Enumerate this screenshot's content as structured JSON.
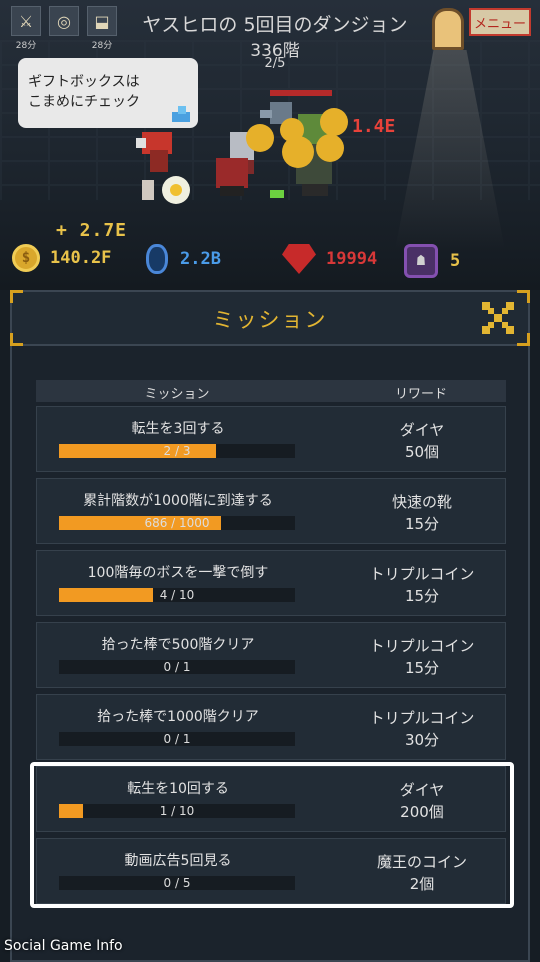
{
  "header": {
    "title": "ヤスヒロの 5回目のダンジョン",
    "floor": "336階",
    "wave": "2/5",
    "menu_label": "メニュー",
    "buffs": [
      {
        "icon": "crossed-swords-icon",
        "time": "28分"
      },
      {
        "icon": "coin-stack-icon",
        "time": ""
      },
      {
        "icon": "boot-icon",
        "time": "28分"
      }
    ]
  },
  "scene": {
    "tip": "ギフトボックスは\nこまめにチェック",
    "damage": "1.4E",
    "coin_gain": "+ 2.7E"
  },
  "currencies": {
    "coins": "140.2F",
    "souls": "2.2B",
    "rubies": "19994",
    "demon_coins": "5"
  },
  "panel": {
    "title": "ミッション",
    "col_mission": "ミッション",
    "col_reward": "リワード",
    "missions": [
      {
        "name": "転生を3回する",
        "progress": "2 / 3",
        "fraction": 0.667,
        "reward": "ダイヤ",
        "amount": "50個"
      },
      {
        "name": "累計階数が1000階に到達する",
        "progress": "686 / 1000",
        "fraction": 0.686,
        "reward": "快速の靴",
        "amount": "15分"
      },
      {
        "name": "100階毎のボスを一撃で倒す",
        "progress": "4 / 10",
        "fraction": 0.4,
        "reward": "トリプルコイン",
        "amount": "15分"
      },
      {
        "name": "拾った棒で500階クリア",
        "progress": "0 / 1",
        "fraction": 0,
        "reward": "トリプルコイン",
        "amount": "15分"
      },
      {
        "name": "拾った棒で1000階クリア",
        "progress": "0 / 1",
        "fraction": 0,
        "reward": "トリプルコイン",
        "amount": "30分"
      },
      {
        "name": "転生を10回する",
        "progress": "1 / 10",
        "fraction": 0.1,
        "reward": "ダイヤ",
        "amount": "200個"
      },
      {
        "name": "動画広告5回見る",
        "progress": "0 / 5",
        "fraction": 0,
        "reward": "魔王のコイン",
        "amount": "2個"
      }
    ]
  },
  "colors": {
    "accent": "#e2b532",
    "progress_fill": "#f29a22",
    "highlight": "#ffffff"
  },
  "watermark": "Social Game Info"
}
